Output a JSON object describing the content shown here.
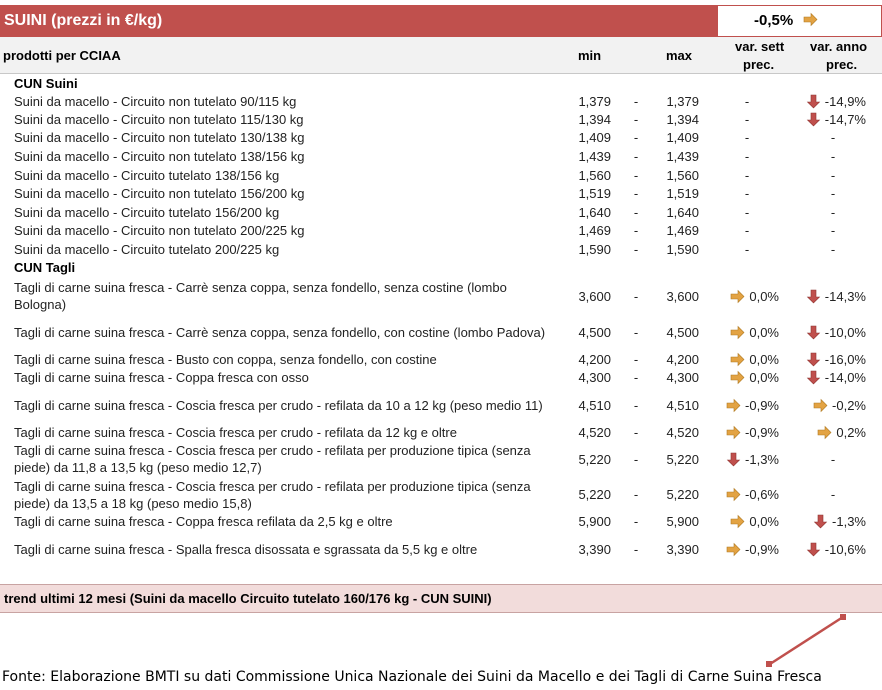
{
  "header": {
    "title": "SUINI (prezzi in €/kg)",
    "summary": {
      "value": "-0,5%",
      "icon": "arrow-right-icon"
    }
  },
  "columns": {
    "product": "prodotti per CCIAA",
    "min": "min",
    "max": "max",
    "week_line1": "var. sett",
    "week_line2": "prec.",
    "year_line1": "var. anno",
    "year_line2": "prec."
  },
  "colors": {
    "header_bg": "#c0504d",
    "arrow_right": "#e3a343",
    "arrow_down": "#c0504d",
    "trend_bg": "#f2dcdb",
    "trend_line": "#c0504d"
  },
  "sections": [
    {
      "title": "CUN Suini",
      "rows": [
        {
          "label": "Suini da macello - Circuito non tutelato 90/115 kg",
          "min": "1,379",
          "dash": "-",
          "max": "1,379",
          "week": {
            "text": "-",
            "icon": ""
          },
          "year": {
            "text": "-14,9%",
            "icon": "arrow-down-icon"
          }
        },
        {
          "label": "Suini da macello - Circuito non tutelato 115/130 kg",
          "min": "1,394",
          "dash": "-",
          "max": "1,394",
          "week": {
            "text": "-",
            "icon": ""
          },
          "year": {
            "text": "-14,7%",
            "icon": "arrow-down-icon"
          }
        },
        {
          "label": "Suini da macello - Circuito non tutelato 130/138 kg",
          "min": "1,409",
          "dash": "-",
          "max": "1,409",
          "week": {
            "text": "-",
            "icon": ""
          },
          "year": {
            "text": "-",
            "icon": ""
          }
        },
        {
          "label": "Suini da macello - Circuito non tutelato 138/156 kg",
          "min": "1,439",
          "dash": "-",
          "max": "1,439",
          "week": {
            "text": "-",
            "icon": ""
          },
          "year": {
            "text": "-",
            "icon": ""
          }
        },
        {
          "label": "Suini da macello - Circuito tutelato 138/156 kg",
          "min": "1,560",
          "dash": "-",
          "max": "1,560",
          "week": {
            "text": "-",
            "icon": ""
          },
          "year": {
            "text": "-",
            "icon": ""
          }
        },
        {
          "label": "Suini da macello - Circuito non tutelato 156/200 kg",
          "min": "1,519",
          "dash": "-",
          "max": "1,519",
          "week": {
            "text": "-",
            "icon": ""
          },
          "year": {
            "text": "-",
            "icon": ""
          }
        },
        {
          "label": "Suini da macello - Circuito tutelato 156/200 kg",
          "min": "1,640",
          "dash": "-",
          "max": "1,640",
          "week": {
            "text": "-",
            "icon": ""
          },
          "year": {
            "text": "-",
            "icon": ""
          }
        },
        {
          "label": "Suini da macello - Circuito non tutelato 200/225 kg",
          "min": "1,469",
          "dash": "-",
          "max": "1,469",
          "week": {
            "text": "-",
            "icon": ""
          },
          "year": {
            "text": "-",
            "icon": ""
          }
        },
        {
          "label": "Suini da macello - Circuito tutelato 200/225 kg",
          "min": "1,590",
          "dash": "-",
          "max": "1,590",
          "week": {
            "text": "-",
            "icon": ""
          },
          "year": {
            "text": "-",
            "icon": ""
          }
        }
      ]
    },
    {
      "title": "CUN Tagli",
      "rows": [
        {
          "label": "Tagli di carne suina fresca - Carrè senza coppa, senza fondello, senza costine (lombo Bologna)",
          "min": "3,600",
          "dash": "-",
          "max": "3,600",
          "week": {
            "text": "0,0%",
            "icon": "arrow-right-icon"
          },
          "year": {
            "text": "-14,3%",
            "icon": "arrow-down-icon"
          }
        },
        {
          "label": "Tagli di carne suina fresca - Carrè senza coppa, senza fondello, con costine (lombo Padova)",
          "min": "4,500",
          "dash": "-",
          "max": "4,500",
          "week": {
            "text": "0,0%",
            "icon": "arrow-right-icon"
          },
          "year": {
            "text": "-10,0%",
            "icon": "arrow-down-icon"
          }
        },
        {
          "label": "Tagli di carne suina fresca - Busto con coppa, senza fondello, con costine",
          "min": "4,200",
          "dash": "-",
          "max": "4,200",
          "week": {
            "text": "0,0%",
            "icon": "arrow-right-icon"
          },
          "year": {
            "text": "-16,0%",
            "icon": "arrow-down-icon"
          }
        },
        {
          "label": "Tagli di carne suina fresca - Coppa fresca con osso",
          "min": "4,300",
          "dash": "-",
          "max": "4,300",
          "week": {
            "text": "0,0%",
            "icon": "arrow-right-icon"
          },
          "year": {
            "text": "-14,0%",
            "icon": "arrow-down-icon"
          }
        },
        {
          "label": "Tagli di carne suina fresca - Coscia fresca per crudo - refilata da 10 a 12 kg (peso medio 11)",
          "min": "4,510",
          "dash": "-",
          "max": "4,510",
          "week": {
            "text": "-0,9%",
            "icon": "arrow-right-icon"
          },
          "year": {
            "text": "-0,2%",
            "icon": "arrow-right-icon"
          }
        },
        {
          "label": "Tagli di carne suina fresca - Coscia fresca per crudo - refilata da 12 kg e oltre",
          "min": "4,520",
          "dash": "-",
          "max": "4,520",
          "week": {
            "text": "-0,9%",
            "icon": "arrow-right-icon"
          },
          "year": {
            "text": "0,2%",
            "icon": "arrow-right-icon"
          }
        },
        {
          "label": "Tagli di carne suina fresca - Coscia fresca per crudo - refilata per produzione tipica (senza piede) da 11,8 a 13,5 kg (peso medio 12,7)",
          "min": "5,220",
          "dash": "-",
          "max": "5,220",
          "week": {
            "text": "-1,3%",
            "icon": "arrow-down-icon"
          },
          "year": {
            "text": "-",
            "icon": ""
          }
        },
        {
          "label": "Tagli di carne suina fresca - Coscia fresca per crudo - refilata per produzione tipica (senza piede) da 13,5 a 18 kg (peso medio 15,8)",
          "min": "5,220",
          "dash": "-",
          "max": "5,220",
          "week": {
            "text": "-0,6%",
            "icon": "arrow-right-icon"
          },
          "year": {
            "text": "-",
            "icon": ""
          }
        },
        {
          "label": "Tagli di carne suina fresca - Coppa fresca refilata da 2,5 kg e oltre",
          "min": "5,900",
          "dash": "-",
          "max": "5,900",
          "week": {
            "text": "0,0%",
            "icon": "arrow-right-icon"
          },
          "year": {
            "text": "-1,3%",
            "icon": "arrow-down-icon"
          }
        },
        {
          "label": "Tagli di carne suina fresca - Spalla fresca disossata e sgrassata da 5,5 kg e oltre",
          "min": "3,390",
          "dash": "-",
          "max": "3,390",
          "week": {
            "text": "-0,9%",
            "icon": "arrow-right-icon"
          },
          "year": {
            "text": "-10,6%",
            "icon": "arrow-down-icon"
          }
        }
      ]
    }
  ],
  "trend": {
    "title": "trend ultimi 12 mesi (Suini da macello Circuito tutelato 160/176 kg - CUN SUINI)"
  },
  "source": "Fonte: Elaborazione BMTI su dati Commissione Unica Nazionale dei Suini da Macello e dei Tagli di Carne Suina Fresca"
}
